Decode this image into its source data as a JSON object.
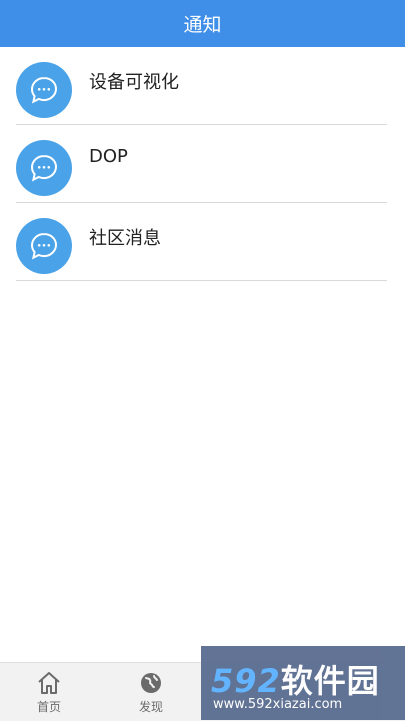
{
  "header": {
    "title": "通知"
  },
  "list": {
    "items": [
      {
        "title": "设备可视化",
        "icon": "chat-bubble-icon"
      },
      {
        "title": "DOP",
        "icon": "chat-bubble-icon"
      },
      {
        "title": "社区消息",
        "icon": "chat-bubble-icon"
      }
    ]
  },
  "tabbar": {
    "tabs": [
      {
        "label": "首页",
        "icon": "home-icon"
      },
      {
        "label": "发现",
        "icon": "globe-icon"
      }
    ]
  },
  "watermark": {
    "brand_num": "592",
    "brand_text": "软件园",
    "url": "www.592xiazai.com"
  },
  "colors": {
    "header_bg": "#3f8ee8",
    "avatar_bg": "#4aa3e8",
    "divider": "#d9d9d9"
  }
}
